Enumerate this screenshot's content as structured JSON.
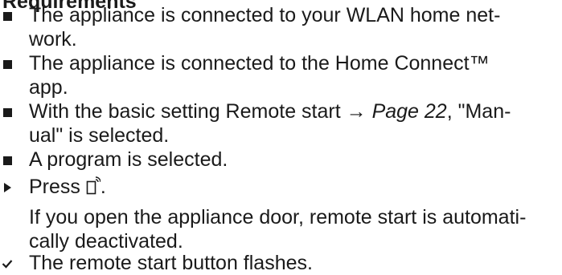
{
  "heading": "Requirements",
  "requirements": [
    {
      "lines": [
        "The appliance is connected to your WLAN home net-",
        "work."
      ]
    },
    {
      "lines": [
        "The appliance is connected to the Home Connect™",
        "app."
      ]
    },
    {
      "line1_prefix": "With the basic setting Remote start → ",
      "page_ref": "Page 22",
      "line1_suffix": ", \"Man-",
      "line2": "ual\" is selected."
    },
    {
      "lines": [
        "A program is selected."
      ]
    }
  ],
  "instruction": {
    "prefix": "Press ",
    "suffix": ".",
    "icon": "remote-start-icon"
  },
  "note": {
    "lines": [
      "If you open the appliance door, remote start is automati-",
      "cally deactivated."
    ]
  },
  "result": {
    "text": "The remote start button flashes."
  }
}
